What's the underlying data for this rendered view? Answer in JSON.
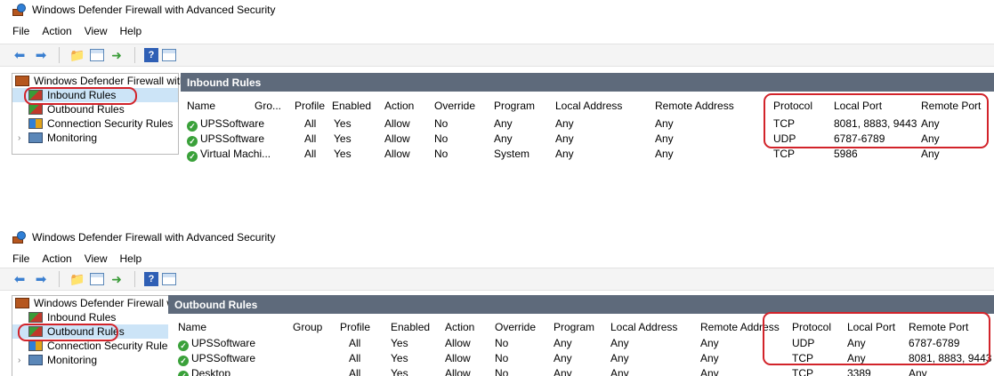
{
  "window": {
    "title": "Windows Defender Firewall with Advanced Security"
  },
  "menu": [
    "File",
    "Action",
    "View",
    "Help"
  ],
  "tree": {
    "root": "Windows Defender Firewall with",
    "items": [
      "Inbound Rules",
      "Outbound Rules",
      "Connection Security Rules",
      "Monitoring"
    ]
  },
  "columns": {
    "name": "Name",
    "group_short": "Gro...",
    "group": "Group",
    "profile": "Profile",
    "enabled": "Enabled",
    "action": "Action",
    "override": "Override",
    "program": "Program",
    "local_address": "Local Address",
    "remote_address": "Remote Address",
    "protocol": "Protocol",
    "local_port": "Local Port",
    "remote_port": "Remote Port"
  },
  "inbound": {
    "title": "Inbound Rules",
    "rows": [
      {
        "name": "UPSSoftware",
        "profile": "All",
        "enabled": "Yes",
        "action": "Allow",
        "override": "No",
        "program": "Any",
        "local_address": "Any",
        "remote_address": "Any",
        "protocol": "TCP",
        "local_port": "8081, 8883, 9443",
        "remote_port": "Any"
      },
      {
        "name": "UPSSoftware",
        "profile": "All",
        "enabled": "Yes",
        "action": "Allow",
        "override": "No",
        "program": "Any",
        "local_address": "Any",
        "remote_address": "Any",
        "protocol": "UDP",
        "local_port": "6787-6789",
        "remote_port": "Any"
      },
      {
        "name": "Virtual Machi...",
        "profile": "All",
        "enabled": "Yes",
        "action": "Allow",
        "override": "No",
        "program": "System",
        "local_address": "Any",
        "remote_address": "Any",
        "protocol": "TCP",
        "local_port": "5986",
        "remote_port": "Any"
      }
    ]
  },
  "outbound": {
    "title": "Outbound Rules",
    "rows": [
      {
        "name": "UPSSoftware",
        "profile": "All",
        "enabled": "Yes",
        "action": "Allow",
        "override": "No",
        "program": "Any",
        "local_address": "Any",
        "remote_address": "Any",
        "protocol": "UDP",
        "local_port": "Any",
        "remote_port": "6787-6789"
      },
      {
        "name": "UPSSoftware",
        "profile": "All",
        "enabled": "Yes",
        "action": "Allow",
        "override": "No",
        "program": "Any",
        "local_address": "Any",
        "remote_address": "Any",
        "protocol": "TCP",
        "local_port": "Any",
        "remote_port": "8081, 8883, 9443"
      },
      {
        "name": "Desktop",
        "profile": "All",
        "enabled": "Yes",
        "action": "Allow",
        "override": "No",
        "program": "Any",
        "local_address": "Any",
        "remote_address": "Any",
        "protocol": "TCP",
        "local_port": "3389",
        "remote_port": "Any"
      }
    ]
  },
  "colors": {
    "panel_header": "#5e6a7b",
    "annotation": "#d2232a",
    "selection": "#cce4f7",
    "enabled_check": "#3aa13a"
  }
}
